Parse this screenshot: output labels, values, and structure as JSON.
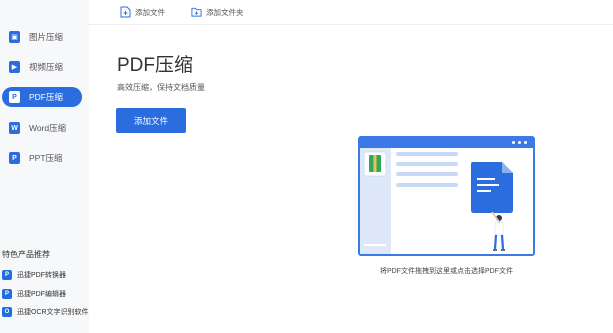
{
  "toolbar": {
    "add_file": "添加文件",
    "add_folder": "添加文件夹"
  },
  "sidebar": {
    "items": [
      {
        "label": "图片压缩",
        "active": false
      },
      {
        "label": "视频压缩",
        "active": false
      },
      {
        "label": "PDF压缩",
        "active": true
      },
      {
        "label": "Word压缩",
        "active": false
      },
      {
        "label": "PPT压缩",
        "active": false
      }
    ],
    "recommend_title": "特色产品推荐",
    "recommend": [
      {
        "label": "迅捷PDF转换器"
      },
      {
        "label": "迅捷PDF编辑器"
      },
      {
        "label": "迅捷OCR文字识别软件"
      }
    ]
  },
  "main": {
    "title": "PDF压缩",
    "subtitle": "高效压缩，保持文档质量",
    "add_button": "添加文件",
    "drop_hint": "将PDF文件拖拽到这里或点击选择PDF文件"
  },
  "colors": {
    "accent": "#2b6cdf",
    "sidebar_bg": "#f7f8fa"
  }
}
